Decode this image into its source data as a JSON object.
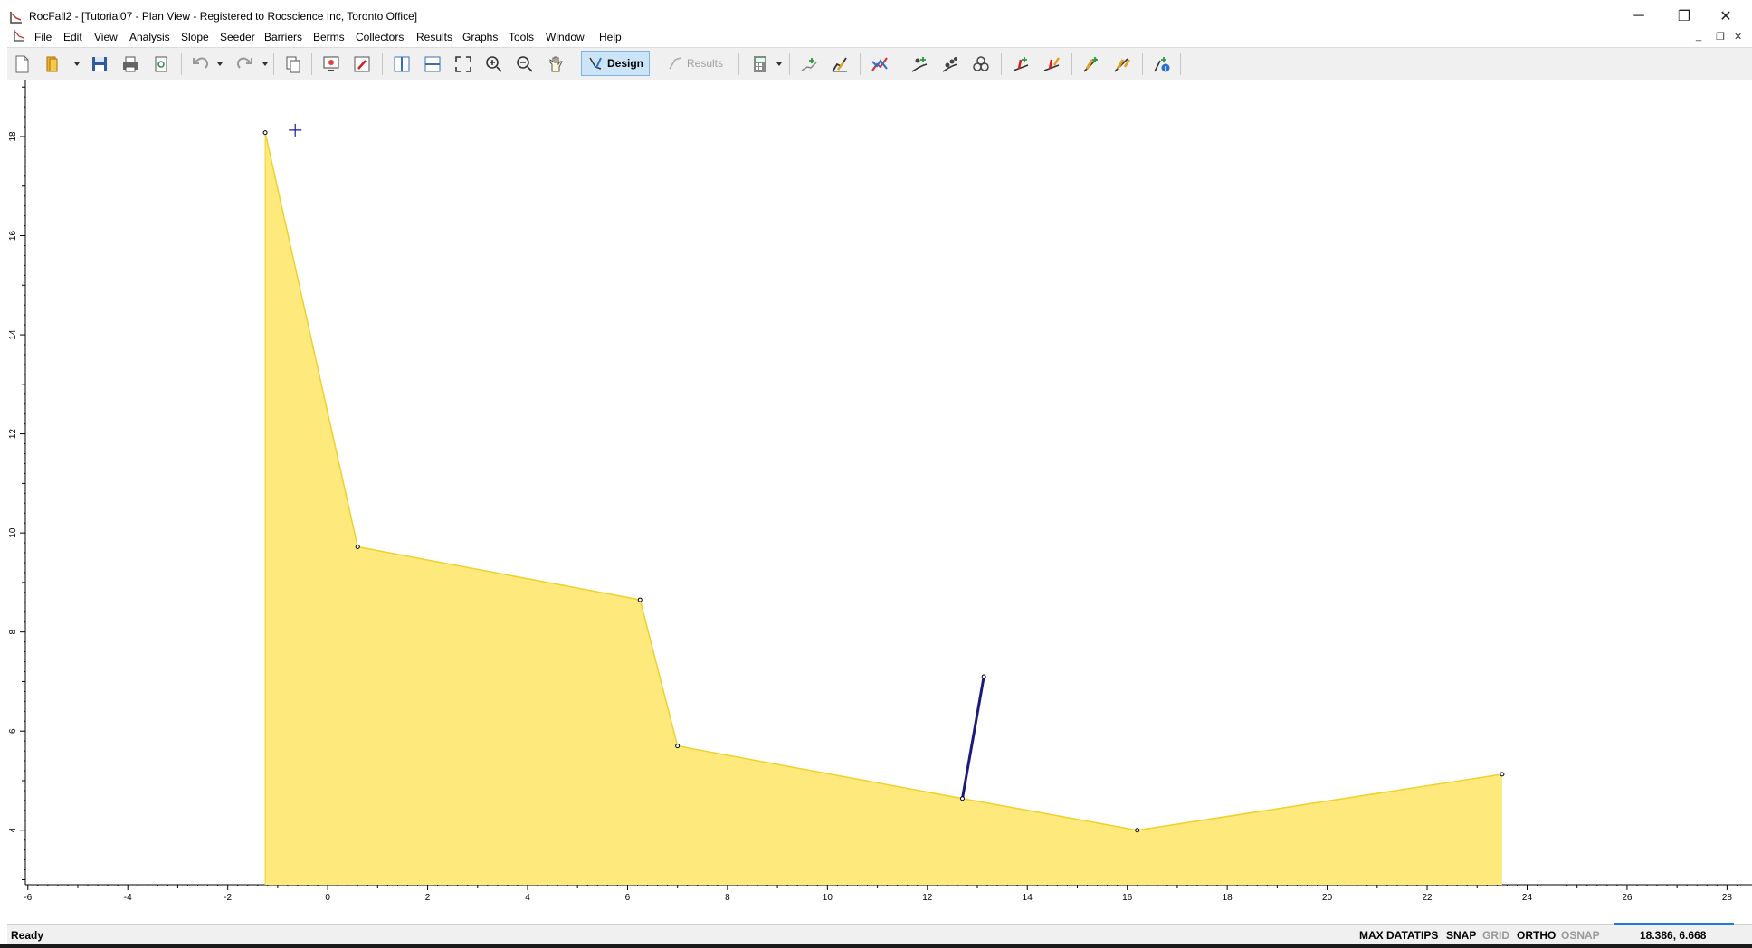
{
  "window": {
    "title": "RocFall2 - [Tutorial07 - Plan View - Registered to Rocscience Inc, Toronto Office]",
    "minimize_glyph": "─",
    "restore_glyph": "❐",
    "close_glyph": "✕"
  },
  "menu": {
    "items": [
      "File",
      "Edit",
      "View",
      "Analysis",
      "Slope",
      "Seeder",
      "Barriers",
      "Berms",
      "Collectors",
      "Results",
      "Graphs",
      "Tools",
      "Window",
      "Help"
    ],
    "mdi_minimize": "_",
    "mdi_restore": "❐",
    "mdi_close": "✕"
  },
  "toolbar": {
    "design_label": "Design",
    "results_label": "Results",
    "buttons": [
      "new-icon",
      "open-icon",
      "save-icon",
      "print-icon",
      "print-preview-icon",
      "undo-icon",
      "redo-icon",
      "copy-icon",
      "export-image-icon",
      "edit-icon",
      "vertical-split-icon",
      "horizontal-split-icon",
      "zoom-extents-icon",
      "zoom-in-icon",
      "zoom-out-icon",
      "pan-icon",
      "design-icon",
      "results-icon",
      "calculator-icon",
      "add-slope-icon",
      "edit-slope-icon",
      "material-icon",
      "add-seeder-icon",
      "point-seeder-icon",
      "line-seeder-icon",
      "add-barrier-icon",
      "edit-barrier-icon",
      "add-collector-icon",
      "edit-collector-icon",
      "info-icon"
    ]
  },
  "canvas": {
    "x_ticks": [
      -6,
      -4,
      -2,
      0,
      2,
      4,
      6,
      8,
      10,
      12,
      14,
      16,
      18,
      20,
      22,
      24,
      26,
      28
    ],
    "y_ticks": [
      4,
      6,
      8,
      10,
      12,
      14,
      16,
      18
    ],
    "x_range": [
      -6.05,
      28.5
    ],
    "y_range": [
      2.9,
      19.15
    ],
    "slope_vertices": [
      [
        -1.25,
        18.08
      ],
      [
        0.6,
        9.72
      ],
      [
        6.25,
        8.65
      ],
      [
        7.0,
        5.7
      ],
      [
        12.7,
        4.64
      ],
      [
        16.2,
        4.0
      ],
      [
        23.5,
        5.13
      ]
    ],
    "slope_fill": "#fde97c",
    "slope_stroke": "#f2cf2a",
    "barrier": {
      "from": [
        12.7,
        4.64
      ],
      "to": [
        13.13,
        7.1
      ],
      "color": "#1a1a7e"
    },
    "cursor_marker": [
      -0.65,
      18.13
    ]
  },
  "status": {
    "ready": "Ready",
    "max_datatips": "MAX DATATIPS",
    "snap": "SNAP",
    "grid": "GRID",
    "ortho": "ORTHO",
    "osnap": "OSNAP",
    "coords": "18.386, 6.668"
  }
}
